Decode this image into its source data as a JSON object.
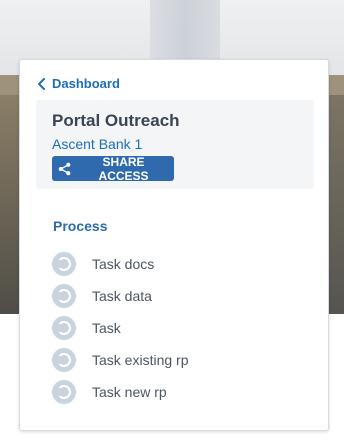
{
  "nav": {
    "back_label": "Dashboard"
  },
  "summary": {
    "title": "Portal Outreach",
    "subtitle": "Ascent Bank 1",
    "share_label": "SHARE ACCESS"
  },
  "process": {
    "heading": "Process",
    "steps": [
      {
        "label": "Task docs"
      },
      {
        "label": "Task data"
      },
      {
        "label": "Task"
      },
      {
        "label": "Task existing rp"
      },
      {
        "label": "Task new rp"
      }
    ]
  },
  "colors": {
    "accent": "#1d6fb8",
    "button": "#2e6aad",
    "step_ring": "#c8d3de",
    "title_text": "#3b4552"
  },
  "icons": {
    "back": "chevron-left-icon",
    "share": "share-icon",
    "step": "pending-circle-icon"
  }
}
